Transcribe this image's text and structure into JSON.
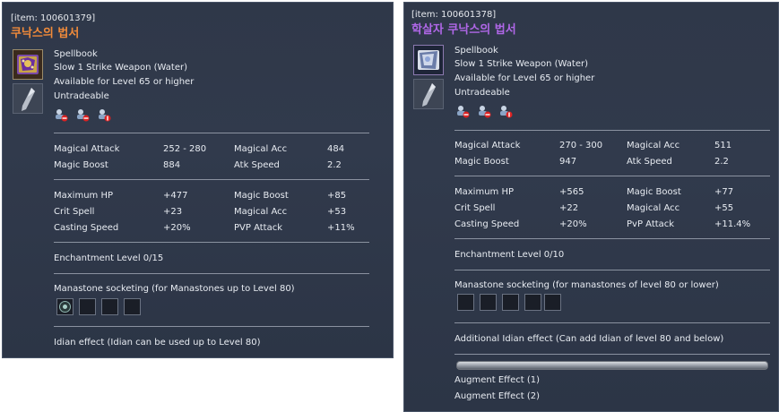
{
  "left": {
    "item_id": "[item: 100601379]",
    "name": "쿠낙스의 법서",
    "name_color": "#f08a3a",
    "icon": "spellbook-icon",
    "type": "Spellbook",
    "weapon_line": "Slow 1 Strike Weapon (Water)",
    "level_line": "Available for Level 65 or higher",
    "trade_line": "Untradeable",
    "restriction_icons": [
      "no-store-icon",
      "no-trade-icon",
      "no-account-icon"
    ],
    "base_stats": [
      {
        "label": "Magical Attack",
        "value": "252 - 280",
        "label2": "Magical Acc",
        "value2": "484"
      },
      {
        "label": "Magic Boost",
        "value": "884",
        "label2": "Atk Speed",
        "value2": "2.2"
      }
    ],
    "bonus_stats": [
      {
        "label": "Maximum HP",
        "value": "+477",
        "label2": "Magic Boost",
        "value2": "+85"
      },
      {
        "label": "Crit Spell",
        "value": "+23",
        "label2": "Magical Acc",
        "value2": "+53"
      },
      {
        "label": "Casting Speed",
        "value": "+20%",
        "label2": "PVP Attack",
        "value2": "+11%"
      }
    ],
    "enchant": "Enchantment Level 0/15",
    "manastone": "Manastone socketing (for Manastones up to Level 80)",
    "idian": "Idian effect (Idian can be used up to Level 80)"
  },
  "right": {
    "item_id": "[item: 100601378]",
    "name": "학살자 쿠낙스의 법서",
    "name_color": "#b067e8",
    "icon": "spellbook-icon",
    "type": "Spellbook",
    "weapon_line": "Slow 1 Strike Weapon (Water)",
    "level_line": "Available for Level 65 or higher",
    "trade_line": "Untradeable",
    "restriction_icons": [
      "no-store-icon",
      "no-trade-icon",
      "no-account-icon"
    ],
    "base_stats": [
      {
        "label": "Magical Attack",
        "value": "270 - 300",
        "label2": "Magical Acc",
        "value2": "511"
      },
      {
        "label": "Magic Boost",
        "value": "947",
        "label2": "Atk Speed",
        "value2": "2.2"
      }
    ],
    "bonus_stats": [
      {
        "label": "Maximum HP",
        "value": "+565",
        "label2": "Magic Boost",
        "value2": "+77"
      },
      {
        "label": "Crit Spell",
        "value": "+22",
        "label2": "Magical Acc",
        "value2": "+55"
      },
      {
        "label": "Casting Speed",
        "value": "+20%",
        "label2": "PvP Attack",
        "value2": "+11.4%"
      }
    ],
    "enchant": "Enchantment Level 0/10",
    "manastone": "Manastone socketing (for manastones of level 80 or lower)",
    "idian": "Additional Idian effect (Can add Idian of level 80 and below)",
    "augment": [
      "Augment Effect (1)",
      "Augment Effect (2)"
    ]
  }
}
